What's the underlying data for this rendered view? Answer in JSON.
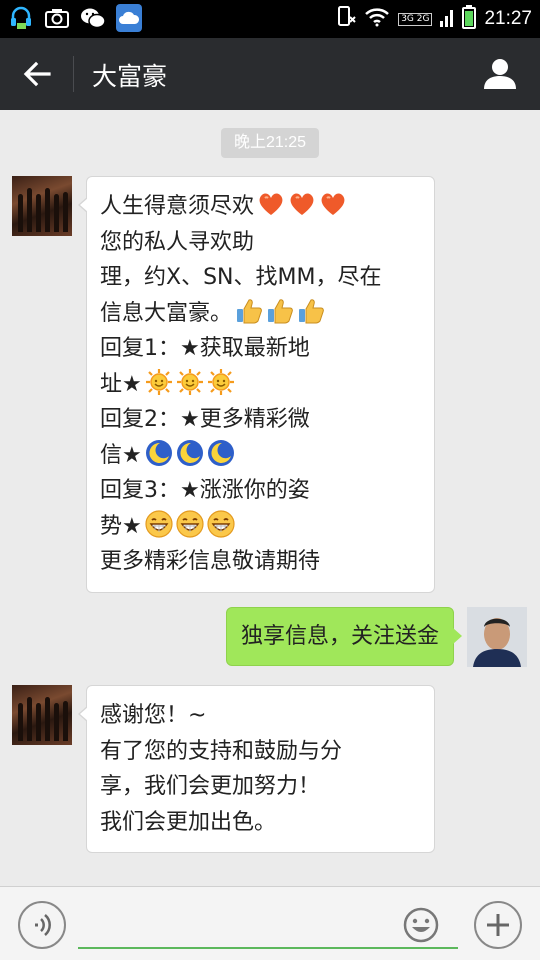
{
  "status_bar": {
    "time": "21:27",
    "network": "3G 2G",
    "icons": [
      "headset-icon",
      "camera-icon",
      "wechat-icon",
      "cloud-icon",
      "phone-rotate-icon",
      "wifi-icon",
      "signal-icon",
      "battery-icon"
    ]
  },
  "header": {
    "title": "大富豪",
    "back_icon": "arrow-left-icon",
    "profile_icon": "person-icon",
    "bg_color": "#2a2c2f"
  },
  "chat": {
    "timestamp": "晚上21:25",
    "messages": [
      {
        "direction": "incoming",
        "lines": [
          {
            "text": "人生得意须尽欢",
            "emoji": "heart-icon",
            "emoji_count": 3
          },
          {
            "text": "您的私人寻欢助"
          },
          {
            "text": "理，约X、SN、找MM，尽在"
          },
          {
            "text": "信息大富豪。",
            "emoji": "thumbs-up-icon",
            "emoji_count": 3
          },
          {
            "text": "回复1：★获取最新地"
          },
          {
            "text": "址★",
            "emoji": "sun-icon",
            "emoji_count": 3
          },
          {
            "text": "回复2：★更多精彩微"
          },
          {
            "text": "信★",
            "emoji": "moon-icon",
            "emoji_count": 3
          },
          {
            "text": "回复3：★涨涨你的姿"
          },
          {
            "text": "势★",
            "emoji": "grin-icon",
            "emoji_count": 3
          },
          {
            "text": "更多精彩信息敬请期待"
          }
        ]
      },
      {
        "direction": "outgoing",
        "text": "独享信息，关注送金",
        "bubble_color": "#a0e75a"
      },
      {
        "direction": "incoming",
        "lines": [
          {
            "text": "感谢您！~"
          },
          {
            "text": "有了您的支持和鼓励与分"
          },
          {
            "text": "享，我们会更加努力！"
          },
          {
            "text": "我们会更加出色。"
          }
        ]
      }
    ]
  },
  "input_bar": {
    "value": "",
    "placeholder": "",
    "voice_icon": "voice-icon",
    "emoji_icon": "smiley-icon",
    "plus_icon": "plus-icon",
    "accent_color": "#5cb85c"
  }
}
